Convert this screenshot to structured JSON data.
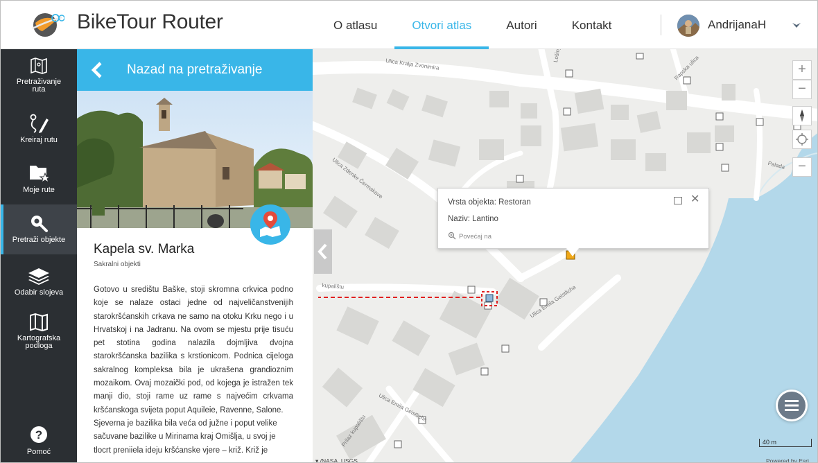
{
  "header": {
    "brand": "BikeTour Router",
    "nav": [
      {
        "label": "O atlasu",
        "active": false
      },
      {
        "label": "Otvori atlas",
        "active": true
      },
      {
        "label": "Autori",
        "active": false
      },
      {
        "label": "Kontakt",
        "active": false
      }
    ],
    "user": {
      "name": "AndrijanaH"
    }
  },
  "sidebar": {
    "items": [
      {
        "label": "Pretraživanje ruta",
        "icon": "map-icon"
      },
      {
        "label": "Kreiraj rutu",
        "icon": "route-draw-icon"
      },
      {
        "label": "Moje rute",
        "icon": "folder-star-icon"
      },
      {
        "label": "Pretraži objekte",
        "icon": "search-icon",
        "active": true
      },
      {
        "label": "Odabir slojeva",
        "icon": "layers-icon"
      },
      {
        "label": "Kartografska podloga",
        "icon": "basemap-icon"
      },
      {
        "label": "Pomoć",
        "icon": "help-icon"
      }
    ]
  },
  "panel": {
    "back_label": "Nazad na pretraživanje",
    "poi": {
      "title": "Kapela sv. Marka",
      "category": "Sakralni objekti",
      "paragraphs": [
        "Gotovo u središtu Baške, stoji skromna crkvica podno koje se nalaze ostaci jedne od najveličanstvenijih starokršćanskih crkava ne samo na otoku Krku nego i u Hrvatskoj i na Jadranu. Na ovom se mjestu prije tisuću pet stotina godina nalazila dojmljiva dvojna starokršćanska bazilika s krstionicom. Podnica cijeloga sakralnog kompleksa bila je ukrašena grandioznim mozaikom. Ovaj mozaički pod, od kojega je istražen tek manji dio, stoji rame uz rame s najvećim crkvama kršćanskoga svijeta poput Aquileie, Ravenne, Salone.",
        "Sjeverna je bazilika bila veća od južne i poput velike sačuvane bazilike u Mirinama kraj Omišlja, u svoj je tlocrt preniiela ideju kršćanske vjere – križ. Križ je"
      ]
    }
  },
  "map": {
    "popup": {
      "type_line": "Vrsta objekta: Restoran",
      "name_line": "Naziv: Lantino",
      "zoom_label": "Povećaj na"
    },
    "street_labels": [
      "Ulica Kralja Zvonimira",
      "Ulica Zdenke Čermakove",
      "Ulica Emila Geistlicha",
      "Ulica Emila Geistlicha",
      "Prilaz kupalištu",
      "kupalištu",
      "Rapska ulica",
      "Lošinjska",
      "Palada"
    ],
    "scale_label": "40 m",
    "attribution_left": "▾ /NASA, USGS",
    "attribution_right": "Powered by Esri",
    "zoom_in": "+",
    "zoom_out": "−",
    "accent_color": "#39b6e8",
    "highlight_color": "#e02020"
  }
}
